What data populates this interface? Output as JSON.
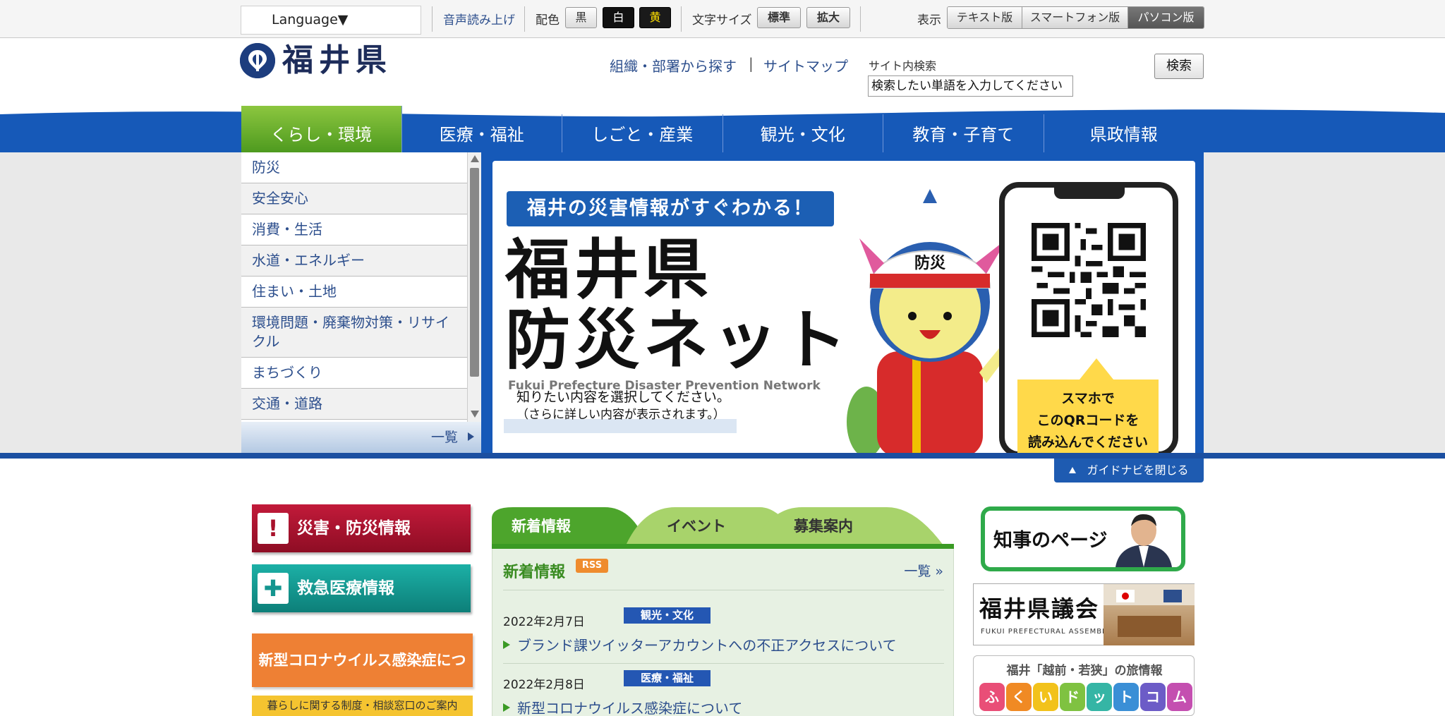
{
  "utility": {
    "language": "Language▼",
    "read_aloud": "音声読み上げ",
    "color_label": "配色",
    "color_black": "黒",
    "color_white": "白",
    "color_yellow": "黄",
    "fontsize_label": "文字サイズ",
    "fontsize_normal": "標準",
    "fontsize_large": "拡大",
    "display_label": "表示",
    "display_text": "テキスト版",
    "display_smart": "スマートフォン版",
    "display_pc": "パソコン版"
  },
  "header": {
    "logo_text": "福井県",
    "org_link": "組織・部署から探す",
    "separator": "|",
    "sitemap_link": "サイトマップ",
    "search_label": "サイト内検索",
    "search_placeholder": "検索したい単語を入力してください",
    "search_button": "検索"
  },
  "nav": {
    "items": [
      "くらし・環境",
      "医療・福祉",
      "しごと・産業",
      "観光・文化",
      "教育・子育て",
      "県政情報"
    ],
    "active": 0
  },
  "guide": {
    "categories": [
      "防災",
      "安全安心",
      "消費・生活",
      "水道・エネルギー",
      "住まい・土地",
      "環境問題・廃棄物対策・リサイクル",
      "まちづくり",
      "交通・道路"
    ],
    "list_all": "一覧",
    "close": "ガイドナビを閉じる",
    "banner": {
      "pill": "福井の災害情報がすぐわかる！",
      "big_line1": "福井県",
      "big_line2": "防災ネット",
      "subtitle": "Fukui Prefecture Disaster Prevention Network",
      "msg1": "知りたい内容を選択してください。",
      "msg2": "（さらに詳しい内容が表示されます。）",
      "helmet": "防災",
      "qr_note": "スマホで\nこのQRコードを\n読み込んでください"
    }
  },
  "side": {
    "disaster": "災害・防災情報",
    "emergency": "救急医療情報",
    "covid": "新型コロナウイルス感染症について",
    "covid_sub": "暮らしに関する制度・相談窓口のご案内"
  },
  "news": {
    "tabs": [
      "新着情報",
      "イベント",
      "募集案内"
    ],
    "heading": "新着情報",
    "rss": "RSS",
    "list_all": "一覧 »",
    "items": [
      {
        "date": "2022年2月7日",
        "tag": "観光・文化",
        "title": "ブランド課ツイッターアカウントへの不正アクセスについて"
      },
      {
        "date": "2022年2月8日",
        "tag": "医療・福祉",
        "title": "新型コロナウイルス感染症について"
      }
    ]
  },
  "right": {
    "governor": "知事のページ",
    "assembly": "福井県議会",
    "assembly_sub": "FUKUI PREFECTURAL ASSEMBLY",
    "tour_text": "福井「越前・若狭」の旅情報",
    "tour_chars": [
      "ふ",
      "く",
      "い",
      "ド",
      "ッ",
      "ト",
      "コ",
      "ム"
    ]
  },
  "colors": {
    "nav_blue": "#1659b8",
    "nav_active_green": "#6cb33f",
    "disaster_red": "#a8112b",
    "emergency_teal": "#14958f",
    "covid_orange": "#ee8034"
  }
}
